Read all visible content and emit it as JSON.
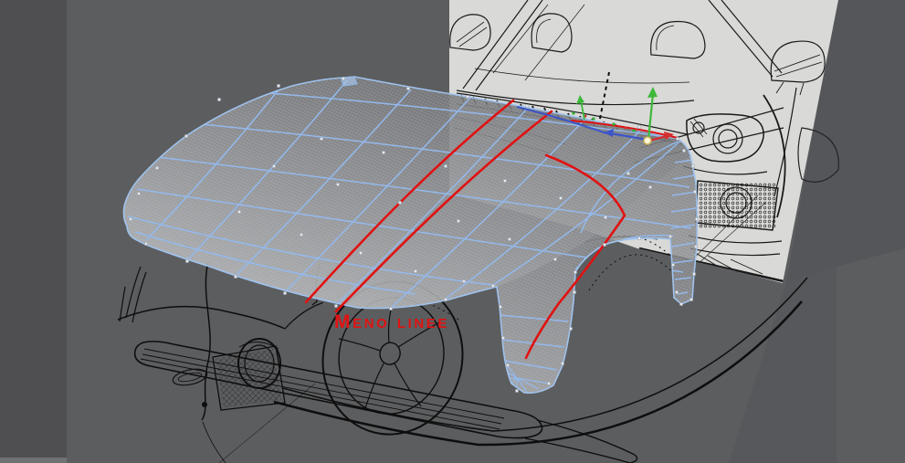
{
  "viewport": {
    "type": "3d-modeling-perspective-viewport",
    "annotation": {
      "text": "Meno linee",
      "color": "#e11212"
    },
    "colors": {
      "background": "#5c5d5f",
      "background_left_band": "#4f4f51",
      "background_shadow_wedge": "#55565a",
      "bottom_left_strip": "#707173",
      "reference_panel": "#d9d9d7",
      "sketch_line": "#111111",
      "mesh_edge_blue": "#93b9ec",
      "mesh_fine_line": "#dde1e6",
      "stripe_red": "#e01212",
      "control_point": "#e7eaef",
      "selected_curve_blue": "#3c55c8"
    },
    "gizmo": {
      "axes": [
        {
          "name": "axis-up",
          "color": "#3db83a"
        },
        {
          "name": "axis-left",
          "color": "#3c55c8"
        },
        {
          "name": "axis-right",
          "color": "#d32f2f"
        }
      ],
      "origin_color": "#fdf6d8"
    }
  }
}
